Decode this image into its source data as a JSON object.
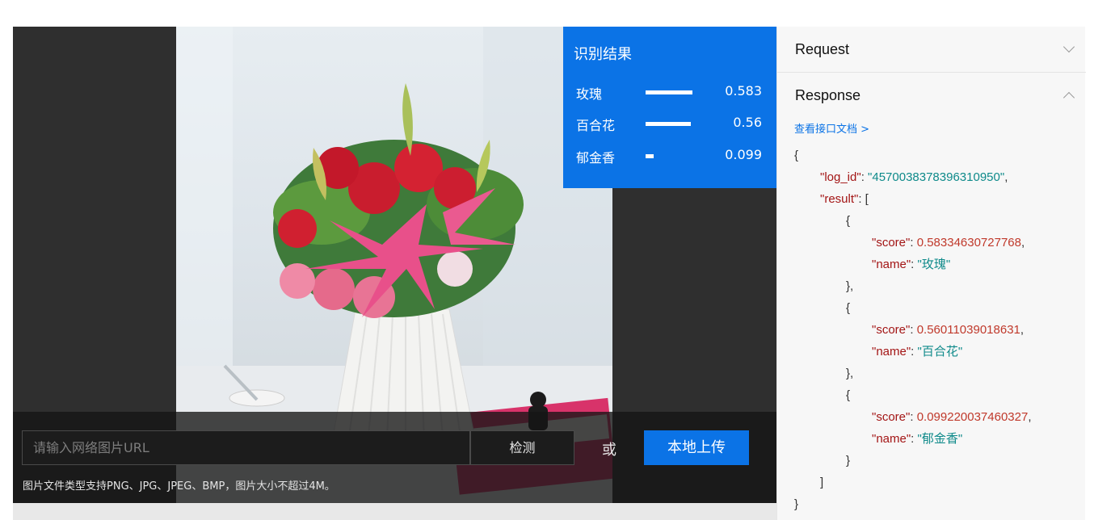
{
  "result": {
    "title": "识别结果",
    "items": [
      {
        "name": "玫瑰",
        "score": "0.583",
        "fraction": 0.583
      },
      {
        "name": "百合花",
        "score": "0.56",
        "fraction": 0.56
      },
      {
        "name": "郁金香",
        "score": "0.099",
        "fraction": 0.099
      }
    ]
  },
  "input_bar": {
    "url_placeholder": "请输入网络图片URL",
    "detect_label": "检测",
    "or_text": "或",
    "upload_label": "本地上传",
    "hint": "图片文件类型支持PNG、JPG、JPEG、BMP，图片大小不超过4M。"
  },
  "panel": {
    "request_label": "Request",
    "response_label": "Response",
    "doc_link": "查看接口文档 >",
    "json": {
      "log_id_key": "\"log_id\"",
      "log_id_val": "\"4570038378396310950\"",
      "result_key": "\"result\"",
      "score_key": "\"score\"",
      "name_key": "\"name\"",
      "entries": [
        {
          "score": "0.58334630727768",
          "name": "\"玫瑰\""
        },
        {
          "score": "0.56011039018631",
          "name": "\"百合花\""
        },
        {
          "score": "0.099220037460327",
          "name": "\"郁金香\""
        }
      ]
    }
  },
  "colors": {
    "accent": "#0b73e6",
    "panel_bg": "#f7f7f7",
    "demo_bg": "#2f2f2f"
  },
  "icons": {
    "request_toggle": "chevron-down-icon",
    "response_toggle": "chevron-up-icon"
  }
}
